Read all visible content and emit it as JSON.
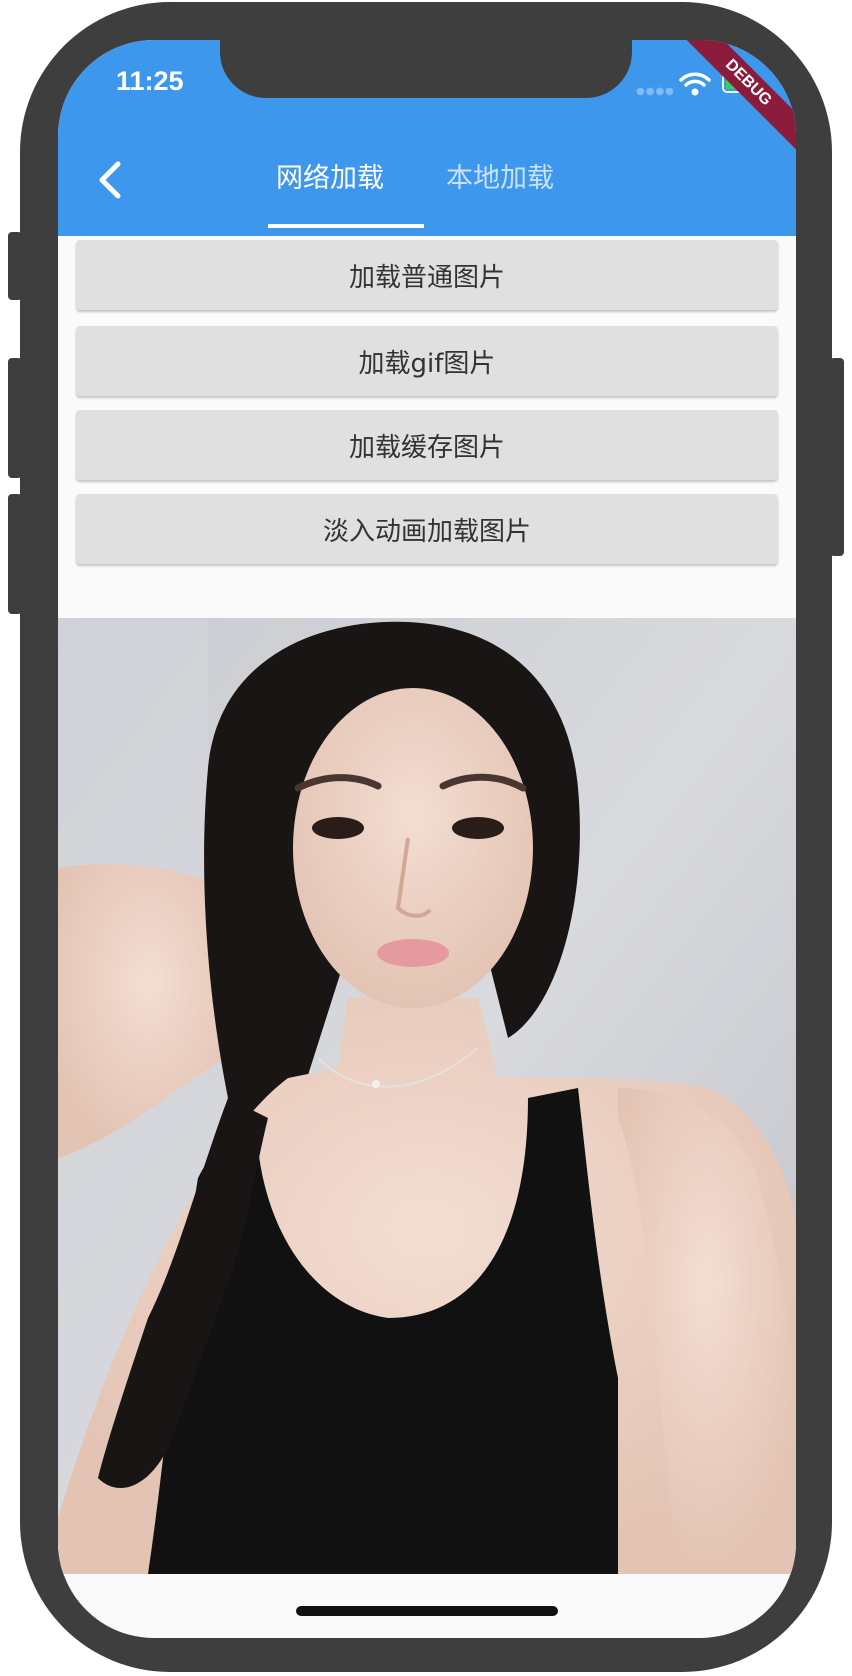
{
  "status_bar": {
    "time": "11:25",
    "debug_label": "DEBUG"
  },
  "app_bar": {
    "back_icon": "back-chevron-icon",
    "tabs": [
      {
        "label": "网络加载",
        "active": true
      },
      {
        "label": "本地加载",
        "active": false
      }
    ],
    "color": "#3d97ed"
  },
  "buttons": [
    {
      "label": "加载普通图片"
    },
    {
      "label": "加载gif图片"
    },
    {
      "label": "加载缓存图片"
    },
    {
      "label": "淡入动画加载图片"
    }
  ],
  "photo": {
    "subject": "photo-of-woman"
  }
}
